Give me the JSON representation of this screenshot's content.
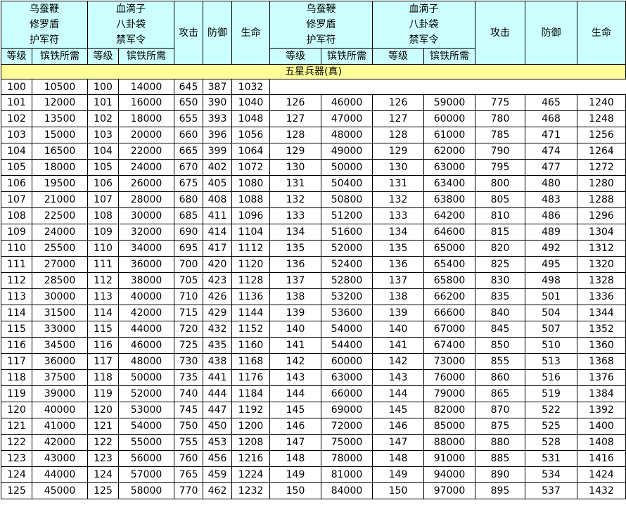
{
  "header": {
    "group_a_lines": [
      "乌蚕鞭",
      "修罗盾",
      "护军符"
    ],
    "group_b_lines": [
      "血滴子",
      "八卦袋",
      "禁军令"
    ],
    "col_attack": "攻击",
    "col_defense": "防御",
    "col_hp": "生命",
    "col_level": "等级",
    "col_iron": "镔铁所需"
  },
  "section_title": "五星兵器(真)",
  "rows": [
    [
      "100",
      "10500",
      "100",
      "14000",
      "645",
      "387",
      "1032",
      "",
      "",
      "",
      "",
      "",
      "",
      ""
    ],
    [
      "101",
      "12000",
      "101",
      "16000",
      "650",
      "390",
      "1040",
      "126",
      "46000",
      "126",
      "59000",
      "775",
      "465",
      "1240"
    ],
    [
      "102",
      "13500",
      "102",
      "18000",
      "655",
      "393",
      "1048",
      "127",
      "47000",
      "127",
      "60000",
      "780",
      "468",
      "1248"
    ],
    [
      "103",
      "15000",
      "103",
      "20000",
      "660",
      "396",
      "1056",
      "128",
      "48000",
      "128",
      "61000",
      "785",
      "471",
      "1256"
    ],
    [
      "104",
      "16500",
      "104",
      "22000",
      "665",
      "399",
      "1064",
      "129",
      "49000",
      "129",
      "62000",
      "790",
      "474",
      "1264"
    ],
    [
      "105",
      "18000",
      "105",
      "24000",
      "670",
      "402",
      "1072",
      "130",
      "50000",
      "130",
      "63000",
      "795",
      "477",
      "1272"
    ],
    [
      "106",
      "19500",
      "106",
      "26000",
      "675",
      "405",
      "1080",
      "131",
      "50400",
      "131",
      "63400",
      "800",
      "480",
      "1280"
    ],
    [
      "107",
      "21000",
      "107",
      "28000",
      "680",
      "408",
      "1088",
      "132",
      "50800",
      "132",
      "63800",
      "805",
      "483",
      "1288"
    ],
    [
      "108",
      "22500",
      "108",
      "30000",
      "685",
      "411",
      "1096",
      "133",
      "51200",
      "133",
      "64200",
      "810",
      "486",
      "1296"
    ],
    [
      "109",
      "24000",
      "109",
      "32000",
      "690",
      "414",
      "1104",
      "134",
      "51600",
      "134",
      "64600",
      "815",
      "489",
      "1304"
    ],
    [
      "110",
      "25500",
      "110",
      "34000",
      "695",
      "417",
      "1112",
      "135",
      "52000",
      "135",
      "65000",
      "820",
      "492",
      "1312"
    ],
    [
      "111",
      "27000",
      "111",
      "36000",
      "700",
      "420",
      "1120",
      "136",
      "52400",
      "136",
      "65400",
      "825",
      "495",
      "1320"
    ],
    [
      "112",
      "28500",
      "112",
      "38000",
      "705",
      "423",
      "1128",
      "137",
      "52800",
      "137",
      "65800",
      "830",
      "498",
      "1328"
    ],
    [
      "113",
      "30000",
      "113",
      "40000",
      "710",
      "426",
      "1136",
      "138",
      "53200",
      "138",
      "66200",
      "835",
      "501",
      "1336"
    ],
    [
      "114",
      "31500",
      "114",
      "42000",
      "715",
      "429",
      "1144",
      "139",
      "53600",
      "139",
      "66600",
      "840",
      "504",
      "1344"
    ],
    [
      "115",
      "33000",
      "115",
      "44000",
      "720",
      "432",
      "1152",
      "140",
      "54000",
      "140",
      "67000",
      "845",
      "507",
      "1352"
    ],
    [
      "116",
      "34500",
      "116",
      "46000",
      "725",
      "435",
      "1160",
      "141",
      "54400",
      "141",
      "67400",
      "850",
      "510",
      "1360"
    ],
    [
      "117",
      "36000",
      "117",
      "48000",
      "730",
      "438",
      "1168",
      "142",
      "60000",
      "142",
      "73000",
      "855",
      "513",
      "1368"
    ],
    [
      "118",
      "37500",
      "118",
      "50000",
      "735",
      "441",
      "1176",
      "143",
      "63000",
      "143",
      "76000",
      "860",
      "516",
      "1376"
    ],
    [
      "119",
      "39000",
      "119",
      "52000",
      "740",
      "444",
      "1184",
      "144",
      "66000",
      "144",
      "79000",
      "865",
      "519",
      "1384"
    ],
    [
      "120",
      "40000",
      "120",
      "53000",
      "745",
      "447",
      "1192",
      "145",
      "69000",
      "145",
      "82000",
      "870",
      "522",
      "1392"
    ],
    [
      "121",
      "41000",
      "121",
      "54000",
      "750",
      "450",
      "1200",
      "146",
      "72000",
      "146",
      "85000",
      "875",
      "525",
      "1400"
    ],
    [
      "122",
      "42000",
      "122",
      "55000",
      "755",
      "453",
      "1208",
      "147",
      "75000",
      "147",
      "88000",
      "880",
      "528",
      "1408"
    ],
    [
      "123",
      "43000",
      "123",
      "56000",
      "760",
      "456",
      "1216",
      "148",
      "78000",
      "148",
      "91000",
      "885",
      "531",
      "1416"
    ],
    [
      "124",
      "44000",
      "124",
      "57000",
      "765",
      "459",
      "1224",
      "149",
      "81000",
      "149",
      "94000",
      "890",
      "534",
      "1424"
    ],
    [
      "125",
      "45000",
      "125",
      "58000",
      "770",
      "462",
      "1232",
      "150",
      "84000",
      "150",
      "97000",
      "895",
      "537",
      "1432"
    ]
  ]
}
